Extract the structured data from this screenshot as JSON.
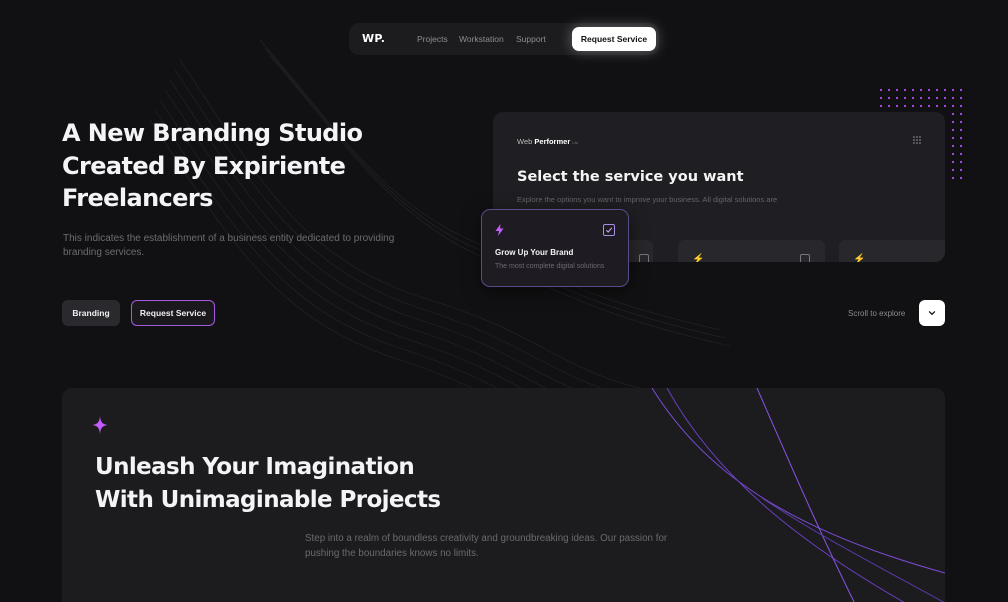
{
  "nav": {
    "logo": "WP.",
    "links": [
      "Projects",
      "Workstation",
      "Support"
    ],
    "cta": "Request Service"
  },
  "hero": {
    "title_lines": [
      "A New Branding Studio",
      "Created By Expiriente",
      "Freelancers"
    ],
    "description": "This indicates the establishment of a business entity dedicated to providing branding services.",
    "buttons": {
      "branding": "Branding",
      "request": "Request Service"
    },
    "scroll_label": "Scroll to explore"
  },
  "service_panel": {
    "brand_light": "Web",
    "brand_bold": "Performer",
    "brand_small": "Ltd",
    "title": "Select the service you want",
    "subtitle": "Explore the options you want to improve your business. All digital solutions are",
    "card": {
      "title": "Grow Up Your Brand",
      "subtitle": "The most complete digital solutions",
      "checked": true
    }
  },
  "section": {
    "title_lines": [
      "Unleash Your Imagination",
      "With Unimaginable Projects"
    ],
    "description": "Step into a realm of boundless creativity and groundbreaking ideas. Our passion for pushing the boundaries knows no limits."
  },
  "colors": {
    "background": "#111012",
    "accent": "#a45be0",
    "accent_bright": "#c25cff",
    "card": "#1f1e22",
    "text": "#f4f4f6"
  },
  "icons": [
    "bolt-icon",
    "checkbox-icon",
    "chevron-down-icon",
    "sparkle-icon",
    "grid-menu-icon"
  ]
}
